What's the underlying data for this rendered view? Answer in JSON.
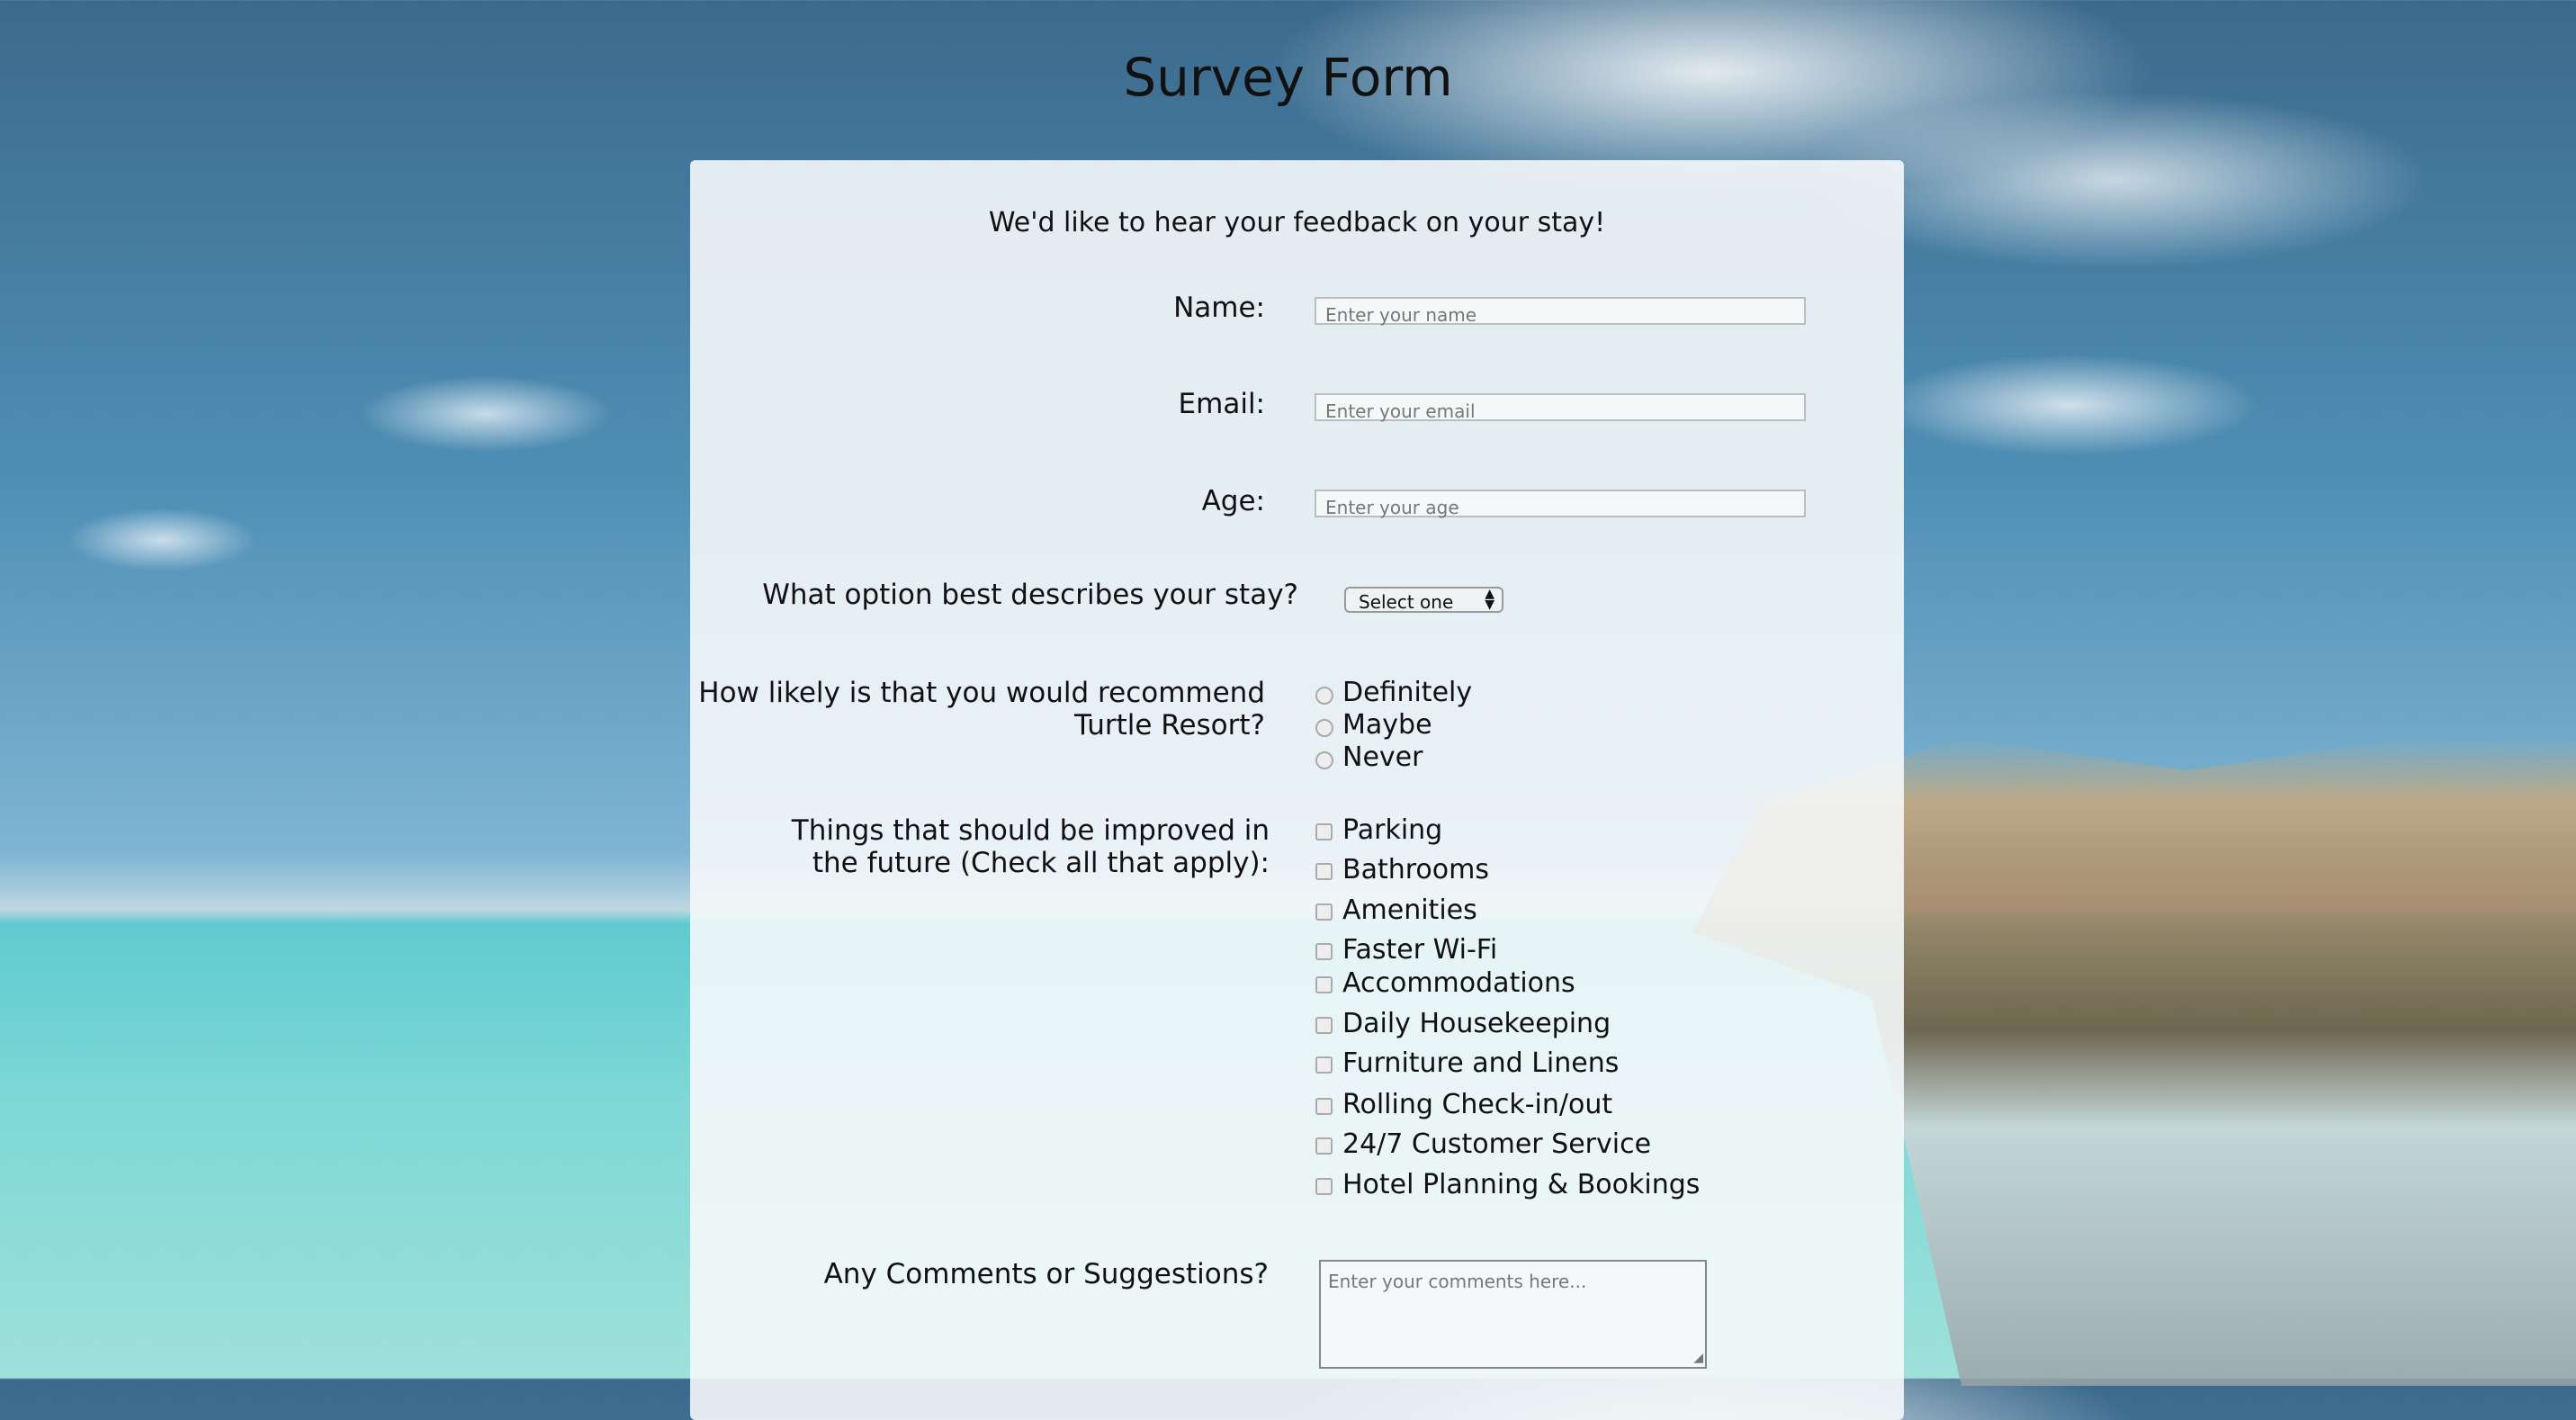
{
  "title": "Survey Form",
  "subtitle": "We'd like to hear your feedback on your stay!",
  "fields": {
    "name": {
      "label": "Name:",
      "placeholder": "Enter your name"
    },
    "email": {
      "label": "Email:",
      "placeholder": "Enter your email"
    },
    "age": {
      "label": "Age:",
      "placeholder": "Enter your age"
    }
  },
  "stay": {
    "label": "What option best describes your stay?",
    "selected": "Select one"
  },
  "recommend": {
    "label_line1": "How likely is that you would recommend",
    "label_line2": "Turtle Resort?",
    "options": [
      "Definitely",
      "Maybe",
      "Never"
    ]
  },
  "improve": {
    "label_line1": "Things that should be improved in",
    "label_line2": "the future (Check all that apply):",
    "options": [
      "Parking",
      "Bathrooms",
      "Amenities",
      "Faster Wi-Fi",
      "Accommodations",
      "Daily Housekeeping",
      "Furniture and Linens",
      "Rolling Check-in/out",
      "24/7 Customer Service",
      "Hotel Planning & Bookings"
    ]
  },
  "comments": {
    "label": "Any Comments or Suggestions?",
    "placeholder": "Enter your comments here..."
  }
}
